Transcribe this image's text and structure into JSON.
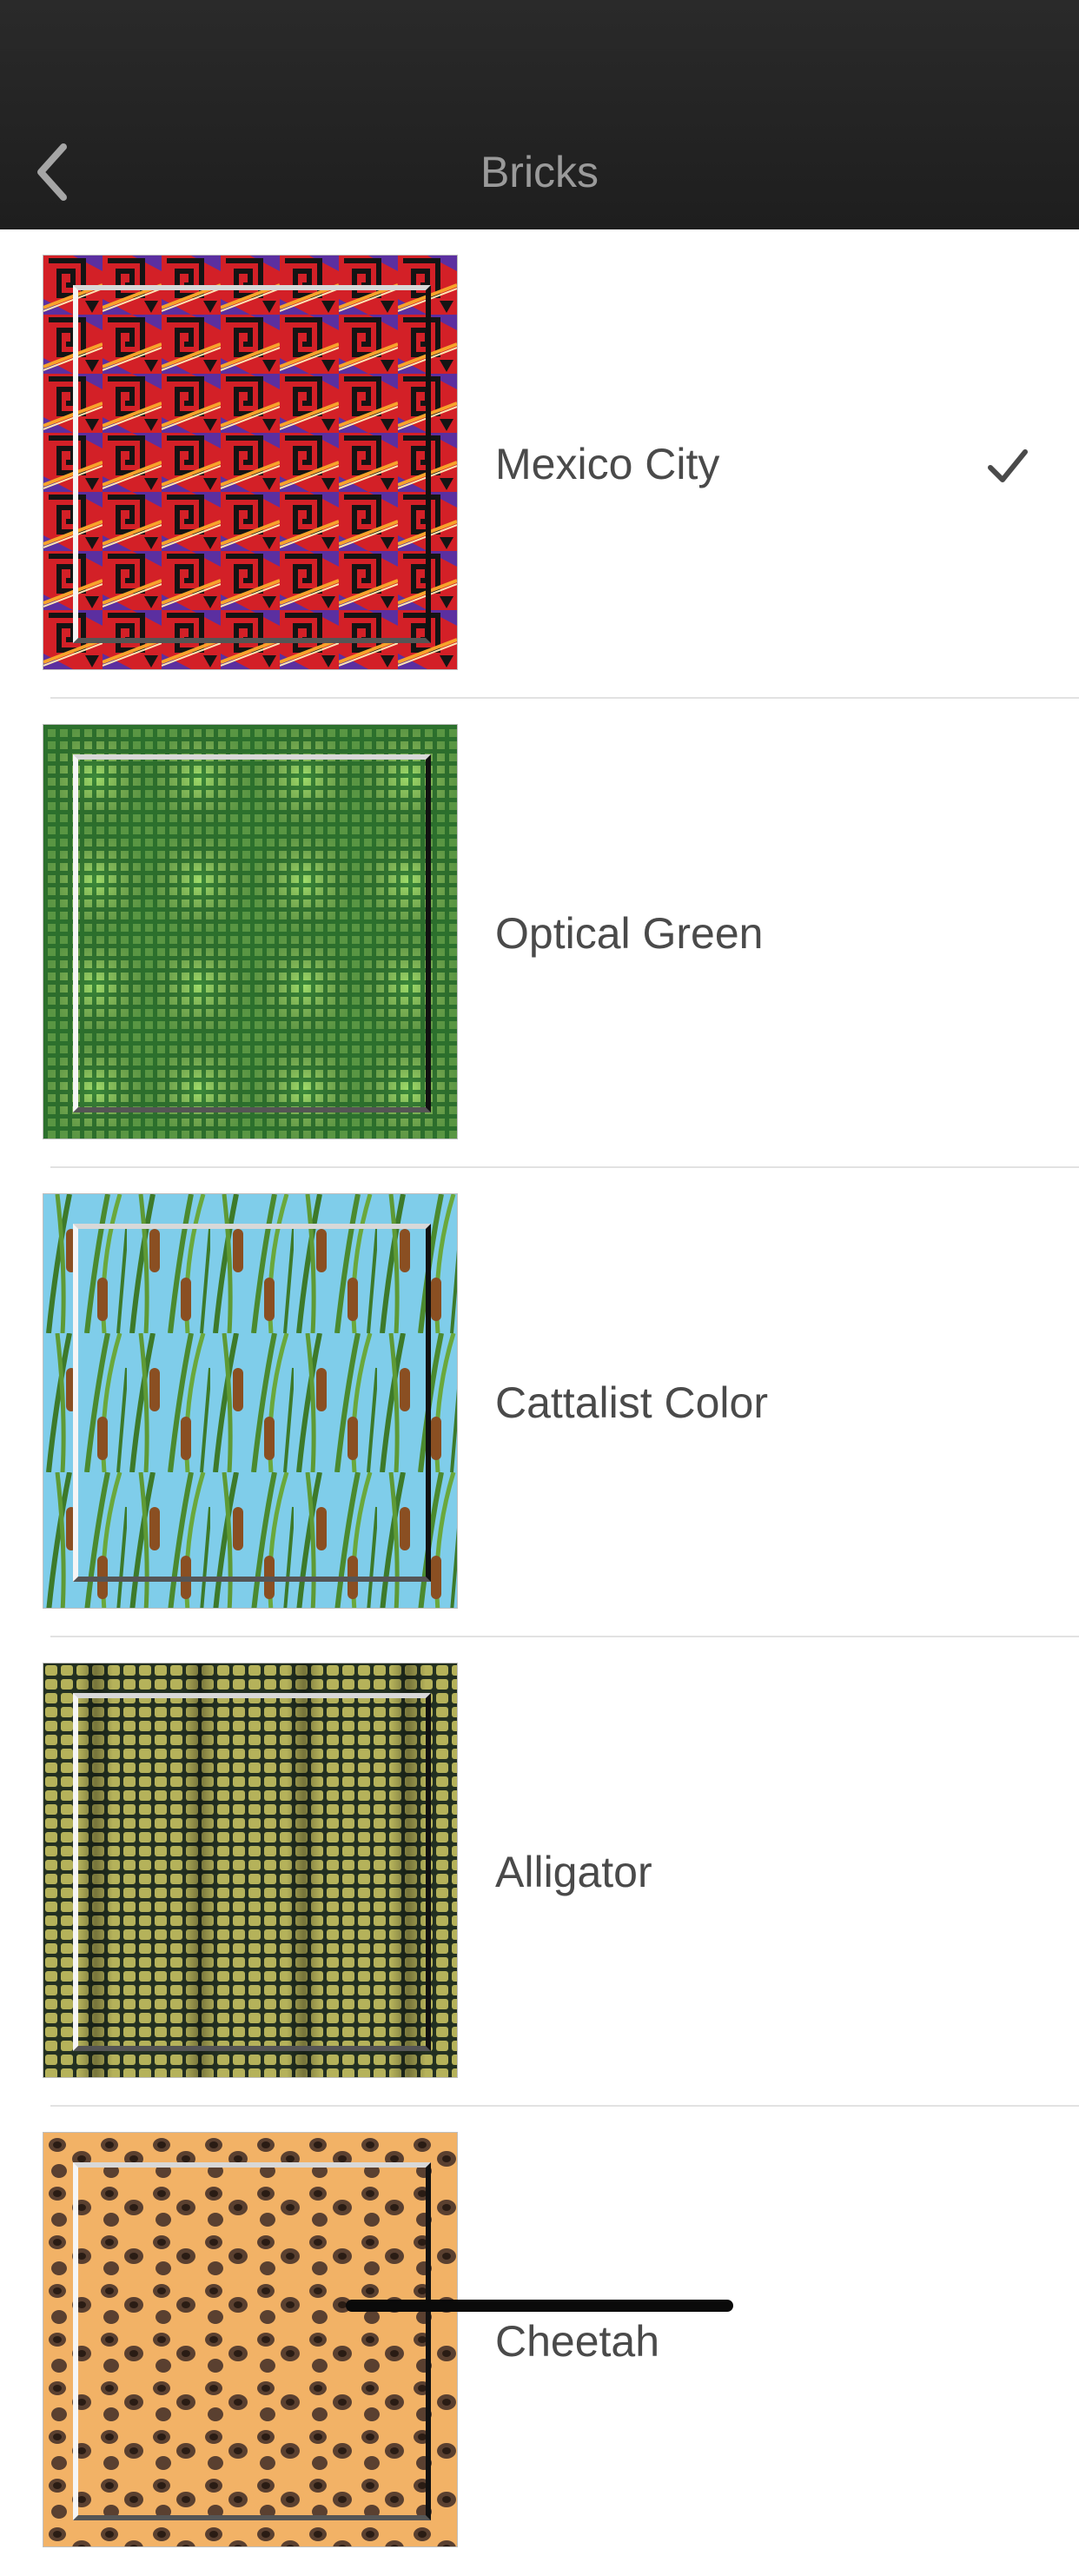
{
  "header": {
    "title": "Bricks",
    "back_icon": "chevron-left-icon"
  },
  "items": [
    {
      "label": "Mexico City",
      "selected": true
    },
    {
      "label": "Optical Green",
      "selected": false
    },
    {
      "label": "Cattalist Color",
      "selected": false
    },
    {
      "label": "Alligator",
      "selected": false
    },
    {
      "label": "Cheetah",
      "selected": false
    }
  ],
  "colors": {
    "navbar": "#222222",
    "title": "#9a9a9a",
    "label": "#4a4a4a",
    "separator": "#e2e2e2"
  }
}
